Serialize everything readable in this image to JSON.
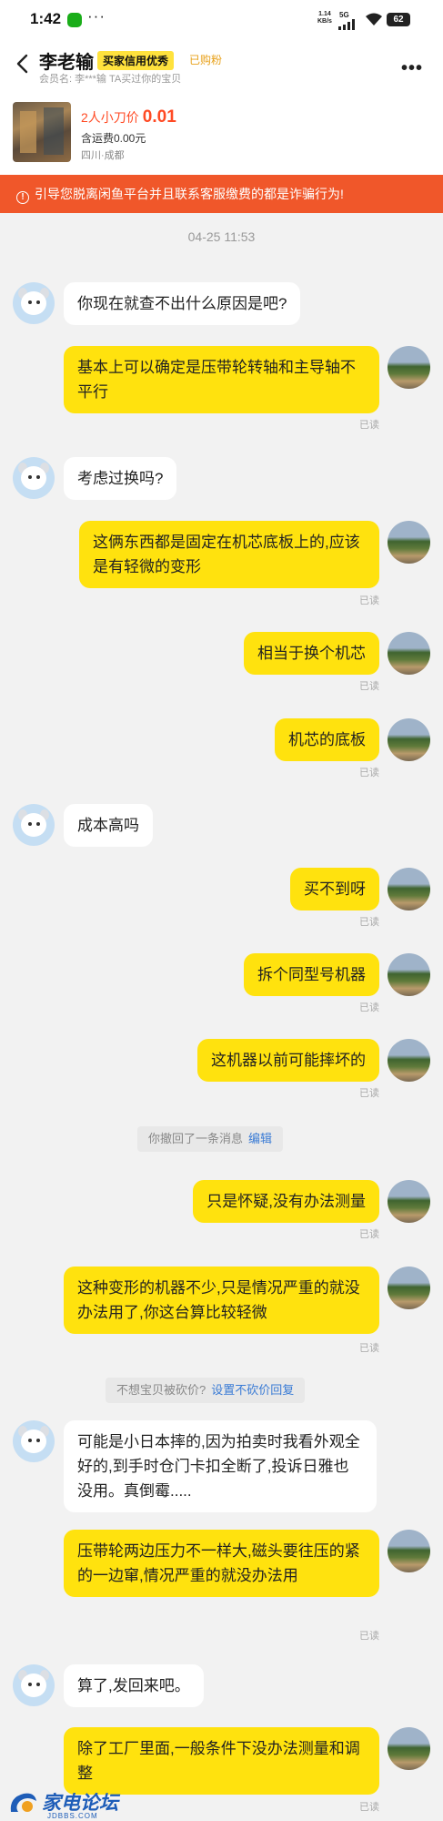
{
  "status_bar": {
    "time": "1:42",
    "dots": "···",
    "net_speed": "1.14",
    "net_unit": "KB/s",
    "network": "5G",
    "battery": "62"
  },
  "header": {
    "name": "李老输",
    "credit_badge": "买家信用优秀",
    "bought": "已购粉",
    "member_line": "会员名:  李***输    TA买过你的宝贝"
  },
  "product": {
    "price_label": "2人小刀价",
    "price_value": "0.01",
    "shipping": "含运费0.00元",
    "location": "四川·成都"
  },
  "warning": {
    "icon": "!",
    "text": "引导您脱离闲鱼平台并且联系客服缴费的都是诈骗行为!"
  },
  "chat": {
    "timestamp": "04-25 11:53",
    "read_label": "已读",
    "messages": [
      "你现在就查不出什么原因是吧?",
      "基本上可以确定是压带轮转轴和主导轴不平行",
      "考虑过换吗?",
      "这俩东西都是固定在机芯底板上的,应该是有轻微的变形",
      "相当于换个机芯",
      "机芯的底板",
      "成本高吗",
      "买不到呀",
      "拆个同型号机器",
      "这机器以前可能摔坏的",
      "只是怀疑,没有办法测量",
      "这种变形的机器不少,只是情况严重的就没办法用了,你这台算比较轻微",
      "可能是小日本摔的,因为拍卖时我看外观全好的,到手时仓门卡扣全断了,投诉日雅也没用。真倒霉.....",
      "压带轮两边压力不一样大,磁头要往压的紧的一边窜,情况严重的就没办法用",
      "算了,发回来吧。",
      "除了工厂里面,一般条件下没办法测量和调整"
    ],
    "recall_notice": "你撤回了一条消息",
    "recall_edit": "编辑",
    "bargain_notice": "不想宝贝被砍价?",
    "bargain_link": "设置不砍价回复"
  },
  "watermark": {
    "title": "家电论坛",
    "subtitle": "JDBBS.COM"
  }
}
